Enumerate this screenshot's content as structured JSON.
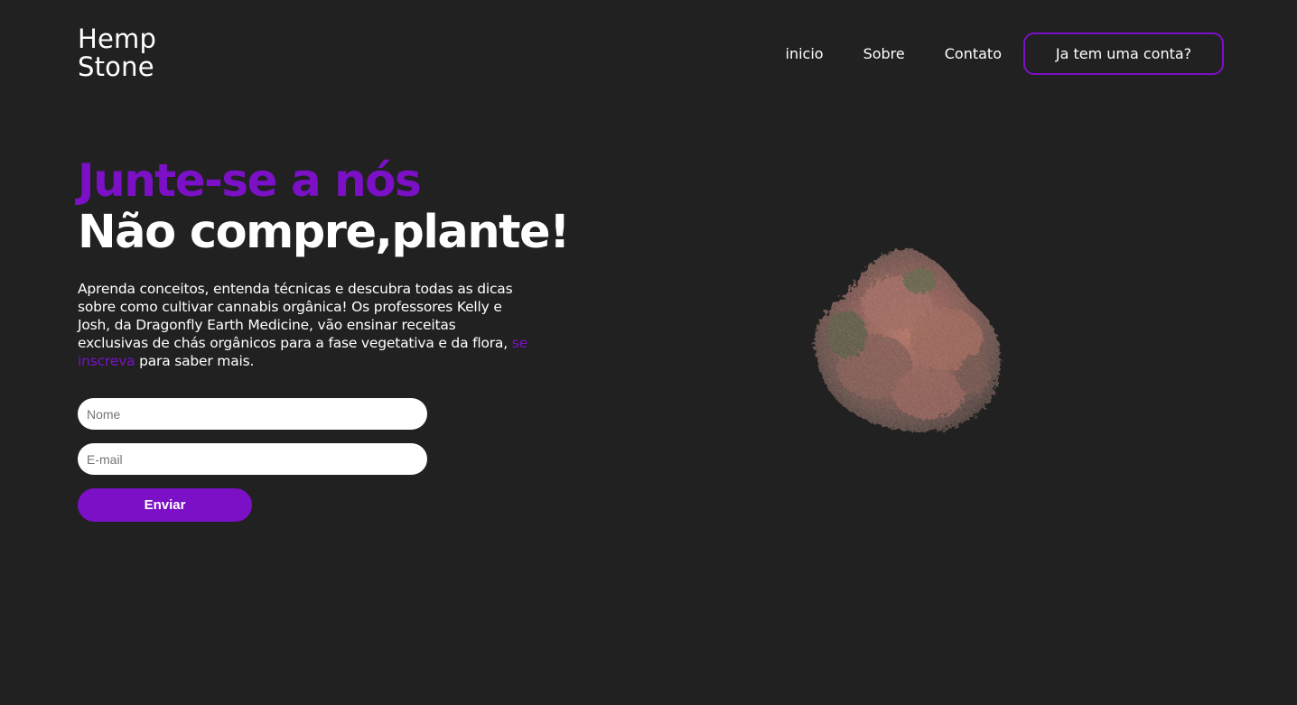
{
  "brand": {
    "line1": "Hemp",
    "line2": "Stone"
  },
  "nav": {
    "items": [
      "inicio",
      "Sobre",
      "Contato"
    ],
    "login_label": "Ja tem uma conta?"
  },
  "hero": {
    "title_line1": "Junte-se a nós",
    "title_line2": "Não compre,plante!",
    "description_before": "Aprenda conceitos, entenda técnicas e descubra todas as dicas sobre como cultivar cannabis orgânica! Os professores Kelly e Josh, da Dragonfly Earth Medicine, vão ensinar receitas exclusivas de chás orgânicos para a fase vegetativa e da flora,",
    "description_link": "se inscreva",
    "description_after": "para saber mais."
  },
  "form": {
    "name_placeholder": "Nome",
    "email_placeholder": "E-mail",
    "submit_label": "Enviar"
  },
  "colors": {
    "background": "#212121",
    "accent": "#7b10c7",
    "text": "#ffffff"
  }
}
